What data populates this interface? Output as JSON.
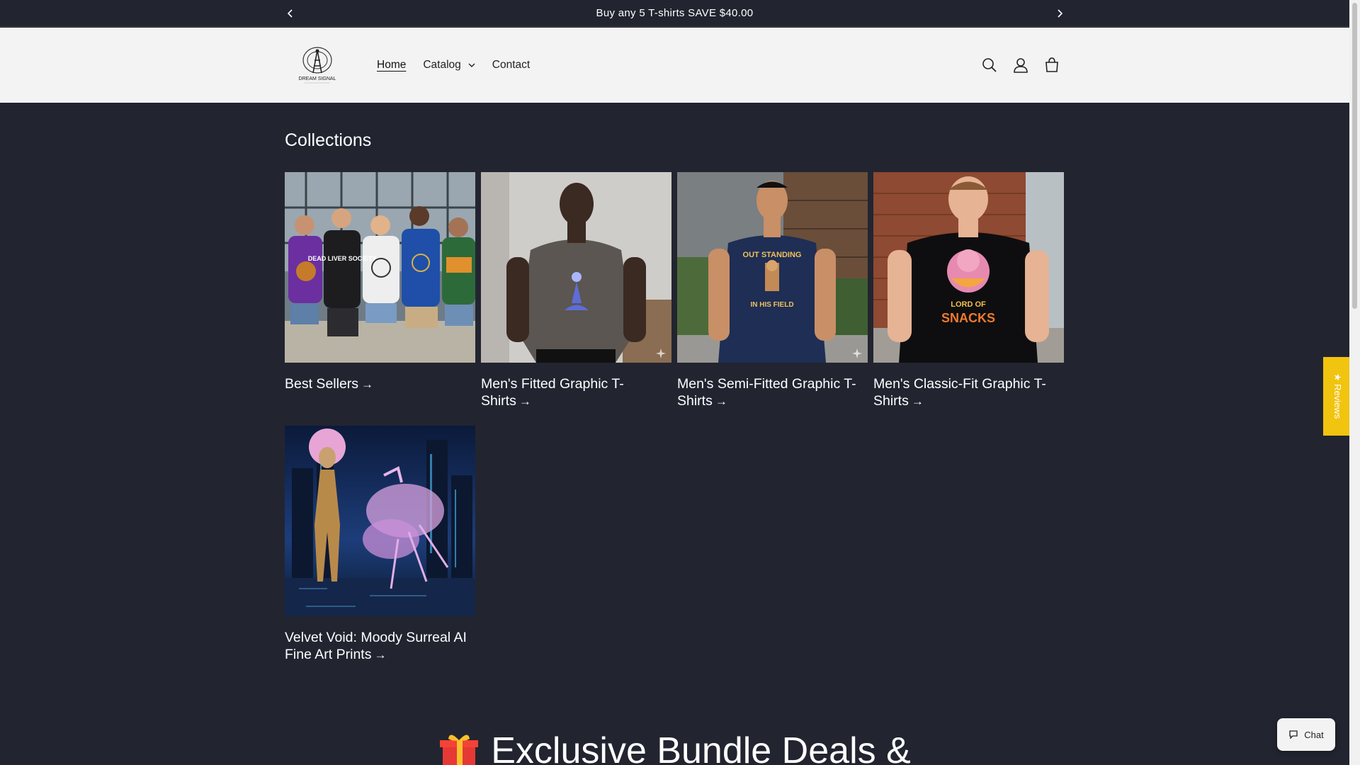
{
  "announcement": {
    "message": "Buy any 5 T-shirts SAVE $40.00"
  },
  "header": {
    "logo_text": "DREAM SIGNAL",
    "nav": [
      {
        "label": "Home",
        "active": true
      },
      {
        "label": "Catalog",
        "has_dropdown": true
      },
      {
        "label": "Contact"
      }
    ],
    "icons": [
      "search-icon",
      "account-icon",
      "cart-icon"
    ]
  },
  "collections": {
    "title": "Collections",
    "items": [
      {
        "label": "Best Sellers"
      },
      {
        "label": "Men's Fitted Graphic T-Shirts"
      },
      {
        "label": "Men's Semi-Fitted Graphic T-Shirts"
      },
      {
        "label": "Men's Classic-Fit Graphic T-Shirts"
      },
      {
        "label": "Velvet Void: Moody Surreal AI Fine Art Prints"
      }
    ],
    "shirt_texts": {
      "best_sellers": "DEAD LIVER SOCIETY",
      "semi_fitted_top": "OUT STANDING",
      "semi_fitted_bottom": "IN HIS FIELD",
      "classic_top": "LORD OF",
      "classic_bottom": "SNACKS"
    }
  },
  "bundle": {
    "heading": "Exclusive Bundle Deals &"
  },
  "widgets": {
    "reviews_label": "★ Reviews",
    "chat_label": "Chat"
  },
  "colors": {
    "background": "#222530",
    "header_bg": "#f3f3f3",
    "reviews_tab": "#f1c40f"
  }
}
